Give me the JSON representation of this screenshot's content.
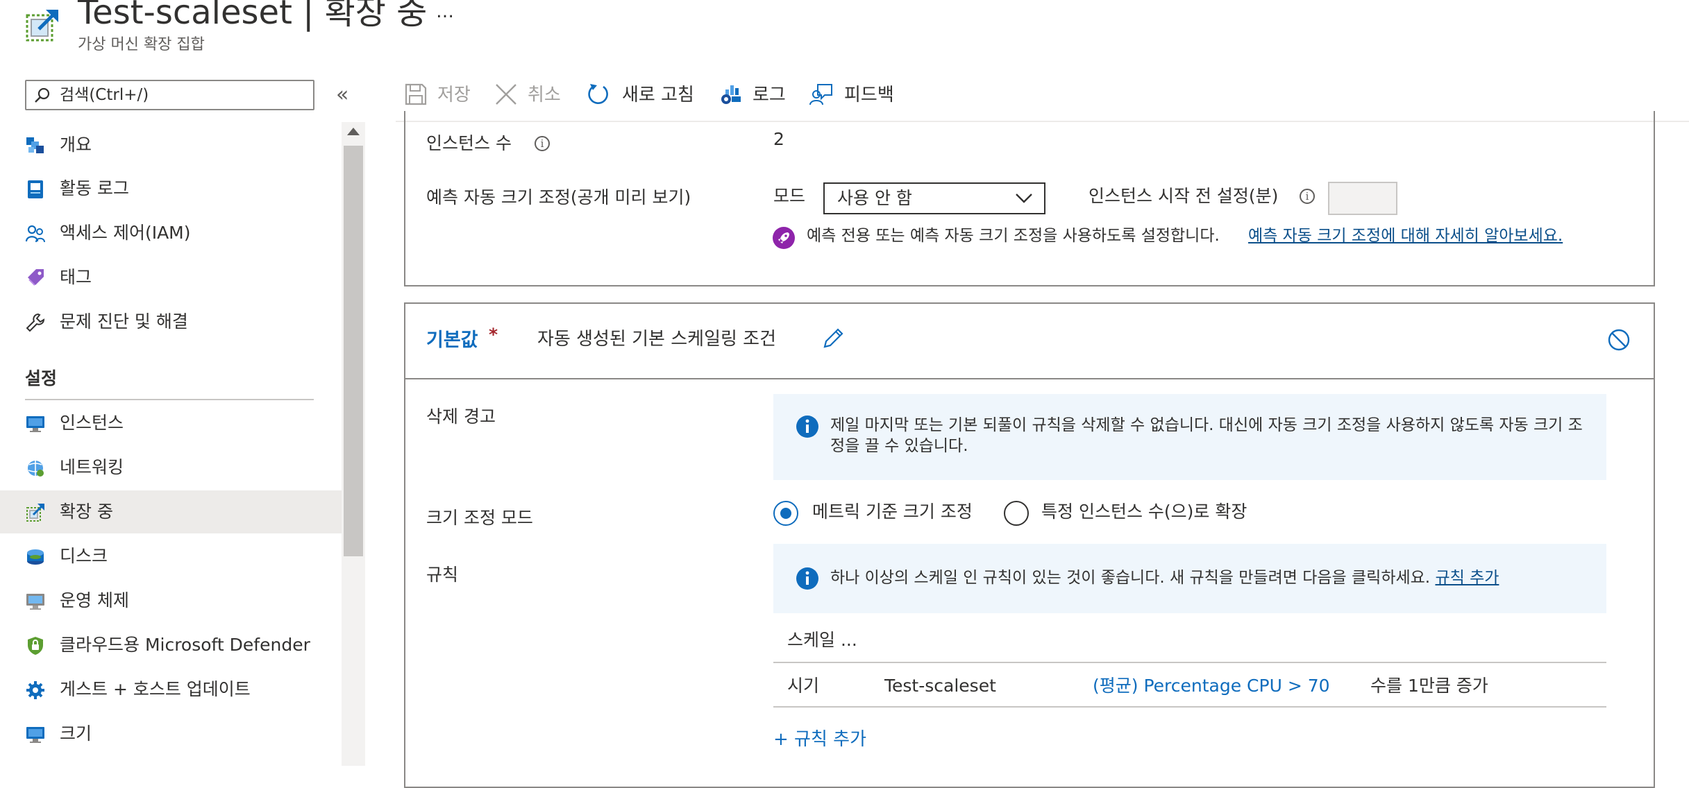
{
  "header": {
    "title": "Test-scaleset | 확장 중",
    "subtitle": "가상 머신 확장 집합",
    "more": "…",
    "icon": "scale-set-icon"
  },
  "sidebar": {
    "search_placeholder": "검색(Ctrl+/)",
    "collapse": "«",
    "items_top": [
      {
        "label": "개요",
        "icon": "overview-icon"
      },
      {
        "label": "활동 로그",
        "icon": "activity-log-icon"
      },
      {
        "label": "액세스 제어(IAM)",
        "icon": "iam-icon"
      },
      {
        "label": "태그",
        "icon": "tag-icon"
      },
      {
        "label": "문제 진단 및 해결",
        "icon": "wrench-icon"
      }
    ],
    "section_settings": "설정",
    "items_settings": [
      {
        "label": "인스턴스",
        "icon": "instances-icon"
      },
      {
        "label": "네트워킹",
        "icon": "networking-icon"
      },
      {
        "label": "확장 중",
        "icon": "scaling-icon",
        "active": true
      },
      {
        "label": "디스크",
        "icon": "disk-icon"
      },
      {
        "label": "운영 체제",
        "icon": "os-icon"
      },
      {
        "label": "클라우드용 Microsoft Defender",
        "icon": "defender-icon"
      },
      {
        "label": "게스트 + 호스트 업데이트",
        "icon": "updates-icon"
      },
      {
        "label": "크기",
        "icon": "size-icon"
      }
    ]
  },
  "toolbar": {
    "save": "저장",
    "discard": "취소",
    "refresh": "새로 고침",
    "logs": "로그",
    "feedback": "피드백"
  },
  "instances": {
    "label": "인스턴스 수",
    "value": "2"
  },
  "predictive": {
    "label": "예측 자동 크기 조정(공개 미리 보기)",
    "mode_label": "모드",
    "mode_value": "사용 안 함",
    "prelaunch_label": "인스턴스 시작 전 설정(분)",
    "prelaunch_value": "",
    "description": "예측 전용 또는 예측 자동 크기 조정을 사용하도록 설정합니다.",
    "learn_more": "예측 자동 크기 조정에 대해 자세히 알아보세요."
  },
  "condition": {
    "default_label": "기본값",
    "required": "*",
    "name": "자동 생성된 기본 스케일링 조건",
    "delete_warning_label": "삭제 경고",
    "delete_warning_text": "제일 마지막 또는 기본 되풀이 규칙을 삭제할 수 없습니다. 대신에 자동 크기 조정을 사용하지 않도록 자동 크기 조정을 끌 수 있습니다.",
    "scale_mode_label": "크기 조정 모드",
    "scale_mode_options": [
      "메트릭 기준 크기 조정",
      "특정 인스턴스 수(으)로 확장"
    ],
    "scale_mode_selected": 0,
    "rules_label": "규칙",
    "rules_info": "하나 이상의 스케일 인 규칙이 있는 것이 좋습니다. 새 규칙을 만들려면 다음을 클릭하세요.",
    "rules_info_link": "규칙 추가",
    "table_header": "스케일 ...",
    "rules": [
      {
        "when": "시기",
        "resource": "Test-scaleset",
        "metric": "(평균) Percentage CPU > 70",
        "action": "수를 1만큼 증가"
      }
    ],
    "add_rule": "+ 규칙 추가"
  },
  "colors": {
    "accent": "#0f6cbd",
    "link": "#0b4f8a",
    "info_bg": "#eff6fc",
    "active_nav": "#edebe9",
    "required": "#a4262c"
  }
}
